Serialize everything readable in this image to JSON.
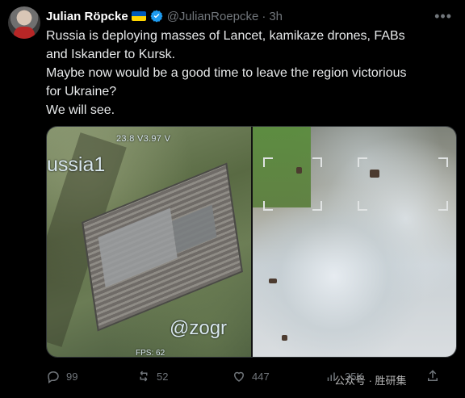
{
  "author": {
    "name": "Julian Röpcke",
    "handle": "@JulianRoepcke",
    "separator": "·",
    "time": "3h"
  },
  "tweet": {
    "lines": [
      "Russia is deploying masses of Lancet, kamikaze drones, FABs",
      "and Iskander to Kursk.",
      "Maybe now would be a good time to leave the region victorious",
      "for Ukraine?",
      "We will see."
    ]
  },
  "media": {
    "left_osd_top": "23.8  V3.97  V",
    "left_osd_label": "ussia1",
    "left_osd_watermark": "@zogr",
    "left_osd_fps": "FPS: 62"
  },
  "actions": {
    "replies": "99",
    "retweets": "52",
    "likes": "447",
    "views": "35K"
  },
  "watermark": {
    "text": "公众号 · 胜研集"
  },
  "colors": {
    "background": "#000000",
    "text_primary": "#e7e9ea",
    "text_secondary": "#71767b",
    "accent": "#1d9bf0"
  },
  "icons": {
    "more": "more-icon",
    "verified": "verified-badge-icon",
    "reply": "reply-icon",
    "retweet": "retweet-icon",
    "like": "heart-icon",
    "views": "views-icon",
    "share": "share-icon"
  }
}
